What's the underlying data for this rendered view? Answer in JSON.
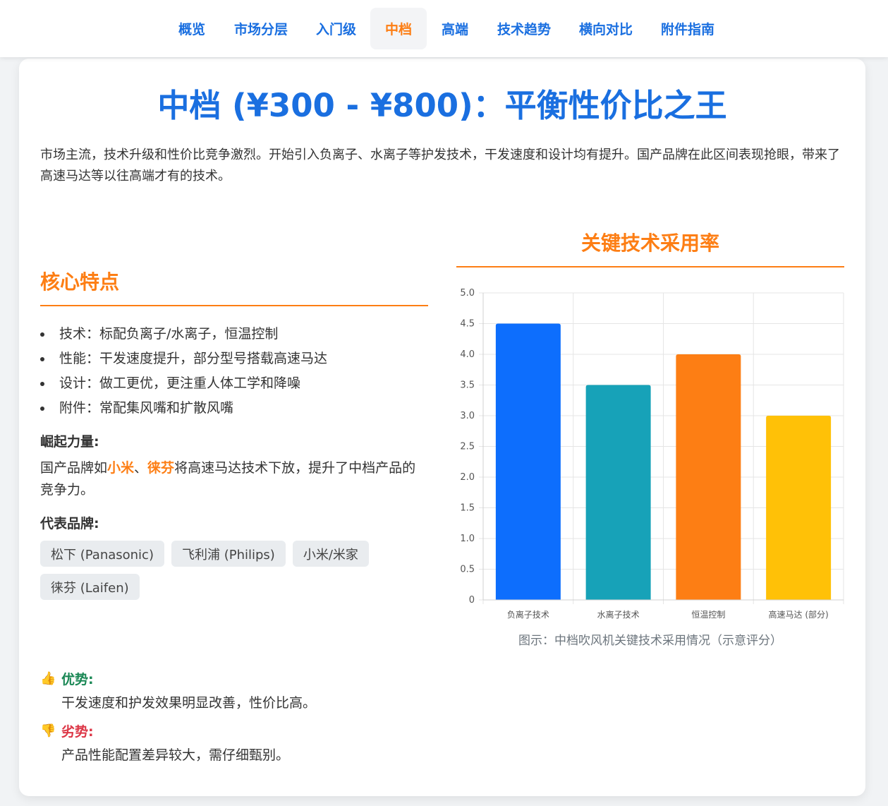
{
  "nav": {
    "items": [
      "概览",
      "市场分层",
      "入门级",
      "中档",
      "高端",
      "技术趋势",
      "横向对比",
      "附件指南"
    ],
    "active": "中档"
  },
  "page": {
    "title": "中档 (¥300 - ¥800)：平衡性价比之王",
    "intro": "市场主流，技术升级和性价比竞争激烈。开始引入负离子、水离子等护发技术，干发速度和设计均有提升。国产品牌在此区间表现抢眼，带来了高速马达等以往高端才有的技术。"
  },
  "core": {
    "title": "核心特点",
    "features": [
      "技术：标配负离子/水离子，恒温控制",
      "性能：干发速度提升，部分型号搭载高速马达",
      "设计：做工更优，更注重人体工学和降噪",
      "附件：常配集风嘴和扩散风嘴"
    ],
    "rise_label": "崛起力量:",
    "rise_prefix": "国产品牌如",
    "rise_brand1": "小米",
    "rise_sep": "、",
    "rise_brand2": "徕芬",
    "rise_suffix": "将高速马达技术下放，提升了中档产品的竞争力。",
    "brands_label": "代表品牌:",
    "brands": [
      "松下 (Panasonic)",
      "飞利浦 (Philips)",
      "小米/米家",
      "徕芬 (Laifen)"
    ]
  },
  "chart_section": {
    "title": "关键技术采用率",
    "caption": "图示：中档吹风机关键技术采用情况（示意评分）"
  },
  "chart_data": {
    "type": "bar",
    "categories": [
      "负离子技术",
      "水离子技术",
      "恒温控制",
      "高速马达 (部分)"
    ],
    "values": [
      4.5,
      3.5,
      4.0,
      3.0
    ],
    "colors": [
      "#0d6efd",
      "#17a2b8",
      "#fd7e14",
      "#ffc107"
    ],
    "ylim": [
      0,
      5
    ],
    "yticks": [
      "5.0",
      "4.5",
      "4.0",
      "3.5",
      "3.0",
      "2.5",
      "2.0",
      "1.5",
      "1.0",
      "0.5",
      "0"
    ],
    "grid": true,
    "legend": "none"
  },
  "pros_cons": {
    "pro_icon": "👍",
    "pro_label": "优势:",
    "pro_text": "干发速度和护发效果明显改善，性价比高。",
    "con_icon": "👎",
    "con_label": "劣势:",
    "con_text": "产品性能配置差异较大，需仔细甄别。"
  }
}
